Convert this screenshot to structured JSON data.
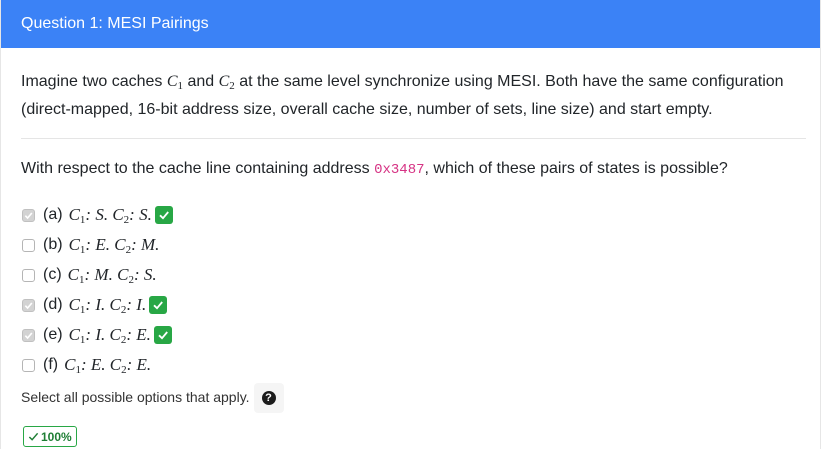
{
  "header": {
    "title": "Question 1: MESI Pairings"
  },
  "question": {
    "intro_a": "Imagine two caches ",
    "c1": "C",
    "sub1": "1",
    "and": " and ",
    "c2": "C",
    "sub2": "2",
    "intro_b": " at the same level synchronize using MESI. Both have the same configuration (direct-mapped, 16-bit address size, overall cache size, number of sets, line size) and start empty.",
    "prompt_a": "With respect to the cache line containing address ",
    "address": "0x3487",
    "prompt_b": ", which of these pairs of states is possible?"
  },
  "options": [
    {
      "letter": "(a)",
      "s1": "S",
      "s2": "S",
      "checked": true,
      "correct": true
    },
    {
      "letter": "(b)",
      "s1": "E",
      "s2": "M",
      "checked": false,
      "correct": false
    },
    {
      "letter": "(c)",
      "s1": "M",
      "s2": "S",
      "checked": false,
      "correct": false
    },
    {
      "letter": "(d)",
      "s1": "I",
      "s2": "I",
      "checked": true,
      "correct": true
    },
    {
      "letter": "(e)",
      "s1": "I",
      "s2": "E",
      "checked": true,
      "correct": true
    },
    {
      "letter": "(f)",
      "s1": "E",
      "s2": "E",
      "checked": false,
      "correct": false
    }
  ],
  "help_text": "Select all possible options that apply.",
  "help_icon": "question-circle-icon",
  "score": "100%",
  "colors": {
    "header": "#3b82f6",
    "correct": "#28a745",
    "code": "#d63384"
  }
}
